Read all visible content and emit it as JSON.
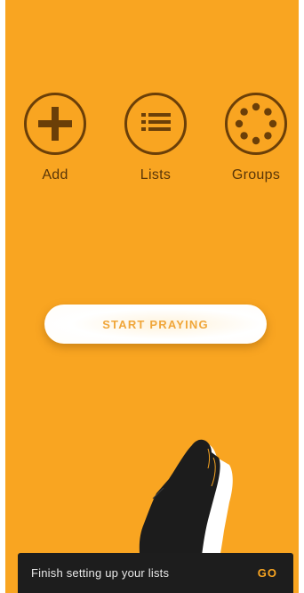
{
  "actions": {
    "add": {
      "label": "Add",
      "icon": "plus-icon"
    },
    "lists": {
      "label": "Lists",
      "icon": "list-icon"
    },
    "groups": {
      "label": "Groups",
      "icon": "dots-circle-icon"
    }
  },
  "start_button": {
    "label": "START PRAYING"
  },
  "illustration": {
    "icon": "praying-hands-icon"
  },
  "snackbar": {
    "message": "Finish setting up your lists",
    "action_label": "GO"
  },
  "colors": {
    "background": "#f9a521",
    "icon_brown": "#6b3f08",
    "snackbar_bg": "#1d1d1d",
    "accent": "#f9a521"
  }
}
